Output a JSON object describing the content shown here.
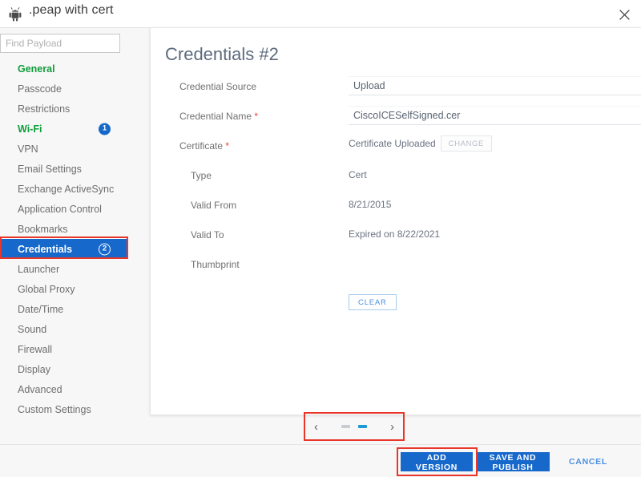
{
  "window": {
    "title": ".peap with cert",
    "icon": "android-icon",
    "close_icon": "close-icon"
  },
  "search": {
    "placeholder": "Find Payload",
    "value": "",
    "icon": "search-input"
  },
  "sidebar": {
    "items": [
      {
        "label": "General",
        "state": "configured",
        "badge": ""
      },
      {
        "label": "Passcode",
        "state": "normal",
        "badge": ""
      },
      {
        "label": "Restrictions",
        "state": "normal",
        "badge": ""
      },
      {
        "label": "Wi-Fi",
        "state": "configured",
        "badge": "1"
      },
      {
        "label": "VPN",
        "state": "normal",
        "badge": ""
      },
      {
        "label": "Email Settings",
        "state": "normal",
        "badge": ""
      },
      {
        "label": "Exchange ActiveSync",
        "state": "normal",
        "badge": ""
      },
      {
        "label": "Application Control",
        "state": "normal",
        "badge": ""
      },
      {
        "label": "Bookmarks",
        "state": "normal",
        "badge": ""
      },
      {
        "label": "Credentials",
        "state": "selected",
        "badge": "2"
      },
      {
        "label": "Launcher",
        "state": "normal",
        "badge": ""
      },
      {
        "label": "Global Proxy",
        "state": "normal",
        "badge": ""
      },
      {
        "label": "Date/Time",
        "state": "normal",
        "badge": ""
      },
      {
        "label": "Sound",
        "state": "normal",
        "badge": ""
      },
      {
        "label": "Firewall",
        "state": "normal",
        "badge": ""
      },
      {
        "label": "Display",
        "state": "normal",
        "badge": ""
      },
      {
        "label": "Advanced",
        "state": "normal",
        "badge": ""
      },
      {
        "label": "Custom Settings",
        "state": "normal",
        "badge": ""
      }
    ]
  },
  "panel": {
    "title": "Credentials #2",
    "fields": {
      "credential_source_label": "Credential Source",
      "credential_source_value": "Upload",
      "credential_name_label": "Credential Name",
      "credential_name_value": "CiscoICESelfSigned.cer",
      "certificate_label": "Certificate",
      "certificate_uploaded_text": "Certificate Uploaded",
      "change_button": "CHANGE",
      "type_label": "Type",
      "type_value": "Cert",
      "valid_from_label": "Valid From",
      "valid_from_value": "8/21/2015",
      "valid_to_label": "Valid To",
      "valid_to_value": "Expired on 8/22/2021",
      "thumbprint_label": "Thumbprint",
      "thumbprint_value": "",
      "clear_button": "CLEAR"
    }
  },
  "pager": {
    "prev_icon": "chevron-left-icon",
    "next_icon": "chevron-right-icon",
    "pages": 2,
    "active_page": 2
  },
  "footer": {
    "add_version": "ADD VERSION",
    "save_and_publish": "SAVE AND PUBLISH",
    "cancel": "CANCEL"
  },
  "colors": {
    "accent_blue": "#1668cb",
    "link_blue": "#4a8fe0",
    "configured_green": "#0f9d3a",
    "highlight_red": "#e8372a",
    "required_red": "#e8443a"
  }
}
